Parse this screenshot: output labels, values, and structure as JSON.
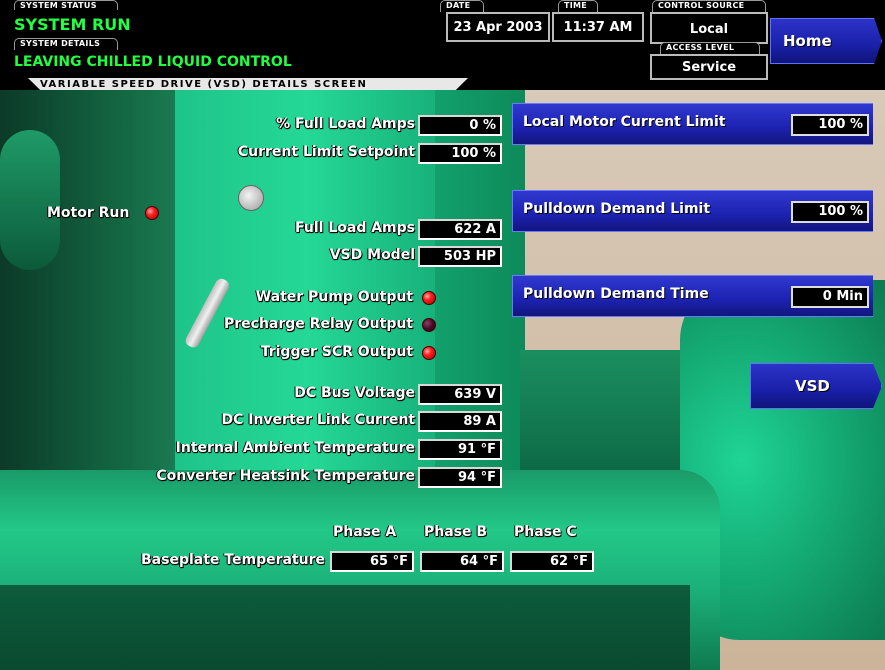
{
  "header": {
    "system_status_tab": "SYSTEM STATUS",
    "system_status": "SYSTEM RUN",
    "system_details_tab": "SYSTEM DETAILS",
    "system_details": "LEAVING CHILLED LIQUID CONTROL",
    "date_tab": "DATE",
    "date": "23 Apr 2003",
    "time_tab": "TIME",
    "time": "11:37 AM",
    "control_source_tab": "CONTROL SOURCE",
    "control_source": "Local",
    "access_level_tab": "ACCESS LEVEL",
    "access_level": "Service",
    "screen_title": "VARIABLE SPEED DRIVE (VSD) DETAILS SCREEN"
  },
  "nav": {
    "home_label": "Home",
    "vsd_label": "VSD"
  },
  "setpoints": [
    {
      "label": "Local Motor Current Limit",
      "value": "100 %"
    },
    {
      "label": "Pulldown Demand Limit",
      "value": "100 %"
    },
    {
      "label": "Pulldown Demand Time",
      "value": "0 Min"
    }
  ],
  "fields": {
    "full_load_amps_pct_label": "% Full Load Amps",
    "full_load_amps_pct": "0 %",
    "current_limit_setpoint_label": "Current Limit Setpoint",
    "current_limit_setpoint": "100 %",
    "motor_run_label": "Motor Run",
    "full_load_amps_label": "Full Load Amps",
    "full_load_amps": "622 A",
    "vsd_model_label": "VSD Model",
    "vsd_model": "503 HP",
    "water_pump_output_label": "Water Pump Output",
    "precharge_relay_output_label": "Precharge Relay Output",
    "trigger_scr_output_label": "Trigger SCR Output",
    "dc_bus_voltage_label": "DC Bus Voltage",
    "dc_bus_voltage": "639 V",
    "dc_inverter_link_current_label": "DC Inverter Link Current",
    "dc_inverter_link_current": "89 A",
    "internal_ambient_temp_label": "Internal Ambient Temperature",
    "internal_ambient_temp": "91 °F",
    "converter_heatsink_temp_label": "Converter Heatsink Temperature",
    "converter_heatsink_temp": "94 °F"
  },
  "indicators": {
    "motor_run": "on",
    "water_pump_output": "on",
    "precharge_relay_output": "off",
    "trigger_scr_output": "on"
  },
  "baseplate": {
    "label": "Baseplate Temperature",
    "phase_headers": [
      "Phase A",
      "Phase B",
      "Phase C"
    ],
    "values": [
      "65 °F",
      "64 °F",
      "62 °F"
    ]
  }
}
